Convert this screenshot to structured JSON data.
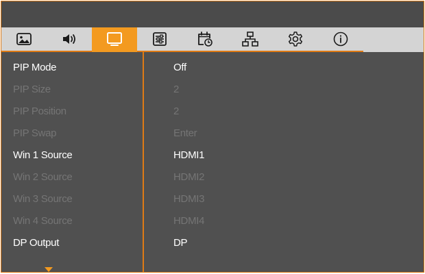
{
  "tabs": [
    {
      "icon": "picture-icon",
      "active": false
    },
    {
      "icon": "speaker-volume-icon",
      "active": false
    },
    {
      "icon": "screen-display-icon",
      "active": true
    },
    {
      "icon": "adjustment-sliders-icon",
      "active": false
    },
    {
      "icon": "calendar-clock-icon",
      "active": false
    },
    {
      "icon": "network-icon",
      "active": false
    },
    {
      "icon": "gear-icon",
      "active": false
    },
    {
      "icon": "info-icon",
      "active": false
    }
  ],
  "settings": [
    {
      "label": "PIP Mode",
      "value": "Off",
      "enabled": true
    },
    {
      "label": "PIP Size",
      "value": "2",
      "enabled": false
    },
    {
      "label": "PIP Position",
      "value": "2",
      "enabled": false
    },
    {
      "label": "PIP Swap",
      "value": "Enter",
      "enabled": false
    },
    {
      "label": "Win 1 Source",
      "value": "HDMI1",
      "enabled": true
    },
    {
      "label": "Win 2 Source",
      "value": "HDMI2",
      "enabled": false
    },
    {
      "label": "Win 3 Source",
      "value": "HDMI3",
      "enabled": false
    },
    {
      "label": "Win 4 Source",
      "value": "HDMI4",
      "enabled": false
    },
    {
      "label": "DP Output",
      "value": "DP",
      "enabled": true
    }
  ],
  "scroll_indicator": "scroll-down-arrow-icon",
  "colors": {
    "accent": "#f39a20",
    "border": "#e07b14",
    "background": "#505050",
    "tab_bar": "#d4d4d4",
    "text_enabled": "#ffffff",
    "text_disabled": "#757575"
  }
}
